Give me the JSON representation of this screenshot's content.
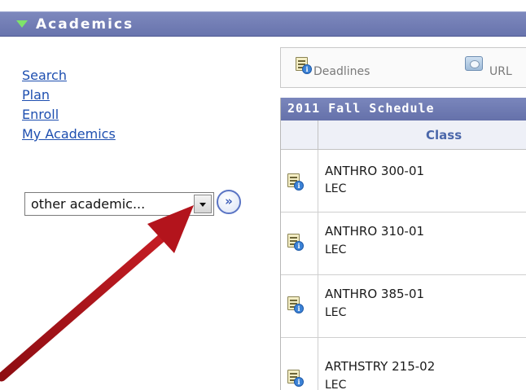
{
  "header": {
    "title": "Academics"
  },
  "nav": {
    "links": [
      "Search",
      "Plan",
      "Enroll",
      "My Academics"
    ]
  },
  "dropdown": {
    "selected": "other academic..."
  },
  "go_button": {
    "glyph": "»"
  },
  "toolbar": {
    "deadlines_label": "Deadlines",
    "url_label": "URL"
  },
  "schedule": {
    "title": "2011 Fall Schedule",
    "column_header": "Class",
    "rows": [
      {
        "course": "ANTHRO 300-01",
        "type": "LEC"
      },
      {
        "course": "ANTHRO 310-01",
        "type": "LEC"
      },
      {
        "course": "ANTHRO 385-01",
        "type": "LEC"
      },
      {
        "course": "ARTHSTRY 215-02",
        "type": "LEC"
      }
    ]
  },
  "colors": {
    "header_bg": "#6e7ab3",
    "link": "#1e4fb0",
    "arrow": "#b3141c"
  }
}
